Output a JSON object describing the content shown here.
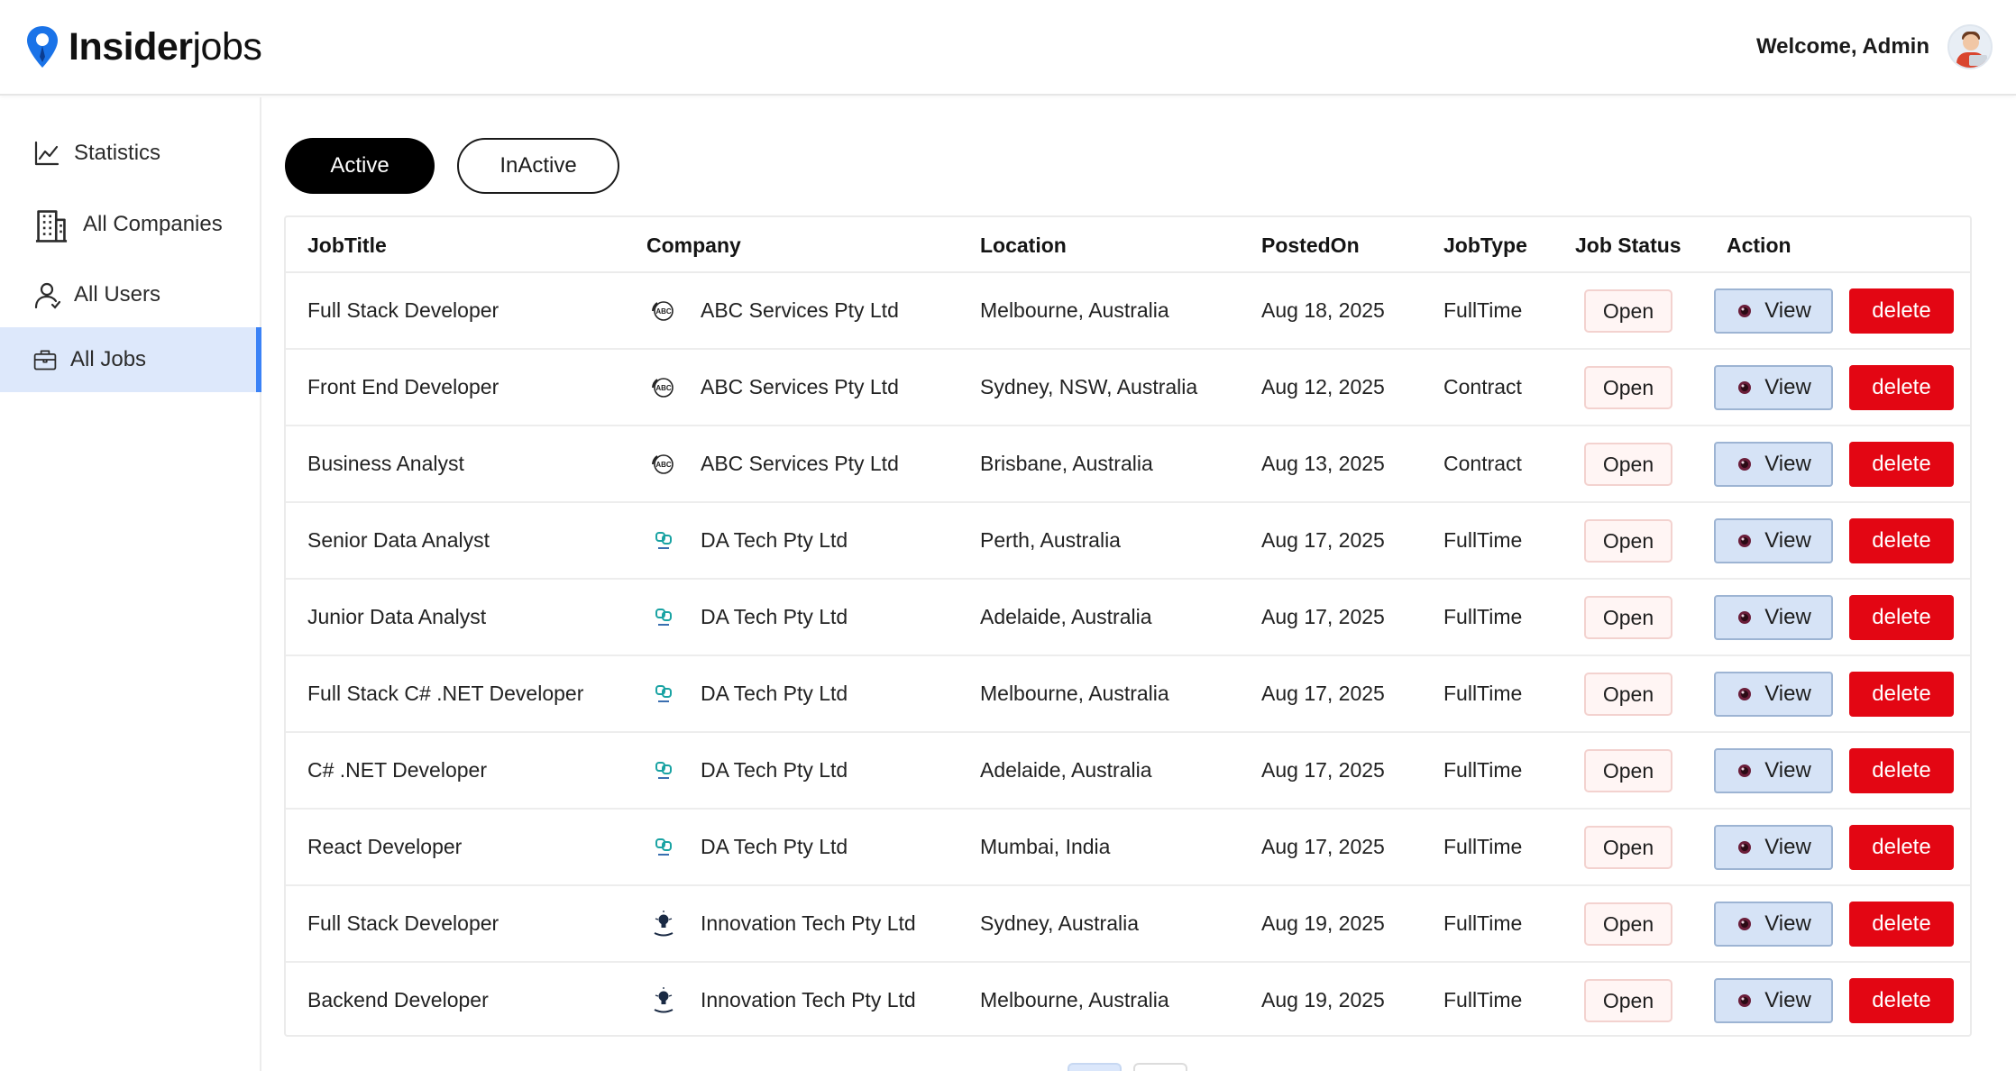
{
  "header": {
    "logo_bold": "Insider",
    "logo_light": "jobs",
    "welcome": "Welcome, Admin",
    "avatar_icon": "user-avatar"
  },
  "sidebar": {
    "items": [
      {
        "label": "Statistics",
        "icon": "chart-line-icon",
        "active": false
      },
      {
        "label": "All Companies",
        "icon": "building-icon",
        "active": false
      },
      {
        "label": "All Users",
        "icon": "user-icon",
        "active": false
      },
      {
        "label": "All Jobs",
        "icon": "briefcase-icon",
        "active": true
      }
    ],
    "active_color": "#3b82f6",
    "active_bg": "#dde8fb"
  },
  "filters": {
    "active_label": "Active",
    "inactive_label": "InActive",
    "selected": "Active"
  },
  "table": {
    "headers": [
      "JobTitle",
      "Company",
      "Location",
      "PostedOn",
      "JobType",
      "Job Status",
      "Action"
    ],
    "view_label": "View",
    "delete_label": "delete",
    "rows": [
      {
        "title": "Full Stack Developer",
        "company": "ABC Services Pty Ltd",
        "logo": "abc",
        "location": "Melbourne, Australia",
        "posted": "Aug 18, 2025",
        "type": "FullTime",
        "status": "Open"
      },
      {
        "title": "Front End Developer",
        "company": "ABC Services Pty Ltd",
        "logo": "abc",
        "location": "Sydney, NSW, Australia",
        "posted": "Aug 12, 2025",
        "type": "Contract",
        "status": "Open"
      },
      {
        "title": "Business Analyst",
        "company": "ABC Services Pty Ltd",
        "logo": "abc",
        "location": "Brisbane, Australia",
        "posted": "Aug 13, 2025",
        "type": "Contract",
        "status": "Open"
      },
      {
        "title": "Senior Data Analyst",
        "company": "DA Tech Pty Ltd",
        "logo": "da",
        "location": "Perth, Australia",
        "posted": "Aug 17, 2025",
        "type": "FullTime",
        "status": "Open"
      },
      {
        "title": "Junior Data Analyst",
        "company": "DA Tech Pty Ltd",
        "logo": "da",
        "location": "Adelaide, Australia",
        "posted": "Aug 17, 2025",
        "type": "FullTime",
        "status": "Open"
      },
      {
        "title": "Full Stack C# .NET Developer",
        "company": "DA Tech Pty Ltd",
        "logo": "da",
        "location": "Melbourne, Australia",
        "posted": "Aug 17, 2025",
        "type": "FullTime",
        "status": "Open"
      },
      {
        "title": "C# .NET Developer",
        "company": "DA Tech Pty Ltd",
        "logo": "da",
        "location": "Adelaide, Australia",
        "posted": "Aug 17, 2025",
        "type": "FullTime",
        "status": "Open"
      },
      {
        "title": "React Developer",
        "company": "DA Tech Pty Ltd",
        "logo": "da",
        "location": "Mumbai, India",
        "posted": "Aug 17, 2025",
        "type": "FullTime",
        "status": "Open"
      },
      {
        "title": "Full Stack Developer",
        "company": "Innovation Tech Pty Ltd",
        "logo": "inno",
        "location": "Sydney, Australia",
        "posted": "Aug 19, 2025",
        "type": "FullTime",
        "status": "Open"
      },
      {
        "title": "Backend Developer",
        "company": "Innovation Tech Pty Ltd",
        "logo": "inno",
        "location": "Melbourne, Australia",
        "posted": "Aug 19, 2025",
        "type": "FullTime",
        "status": "Open"
      }
    ]
  },
  "colors": {
    "brand_blue": "#1a73e8",
    "delete_red": "#e30613",
    "view_bg": "#d6e3f6",
    "status_bg": "#fff5f4"
  }
}
